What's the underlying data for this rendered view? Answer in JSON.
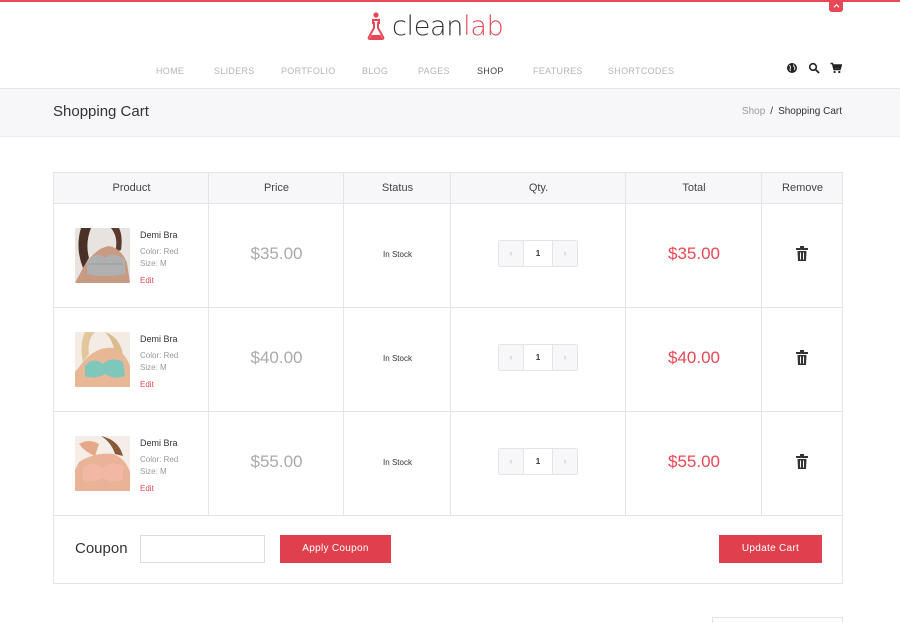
{
  "brand": {
    "name_part1": "clean",
    "name_part2": "lab",
    "accent_color": "#e84855",
    "logo_icon": "flask-person-icon"
  },
  "nav": {
    "items": [
      {
        "label": "HOME",
        "active": false
      },
      {
        "label": "SLIDERS",
        "active": false
      },
      {
        "label": "PORTFOLIO",
        "active": false
      },
      {
        "label": "BLOG",
        "active": false
      },
      {
        "label": "PAGES",
        "active": false
      },
      {
        "label": "SHOP",
        "active": true
      },
      {
        "label": "FEATURES",
        "active": false
      },
      {
        "label": "SHORTCODES",
        "active": false
      }
    ],
    "icons": [
      "globe-icon",
      "search-icon",
      "cart-icon"
    ]
  },
  "page": {
    "title": "Shopping Cart",
    "breadcrumb": {
      "parent": "Shop",
      "separator": "/",
      "current": "Shopping Cart"
    }
  },
  "cart": {
    "columns": [
      "Product",
      "Price",
      "Status",
      "Qty.",
      "Total",
      "Remove"
    ],
    "items": [
      {
        "name": "Demi Bra",
        "color": "Color: Red",
        "size": "Size: M",
        "edit_label": "Edit",
        "price": "$35.00",
        "status": "In Stock",
        "qty": "1",
        "total": "$35.00",
        "product_color": "#b0b0b0"
      },
      {
        "name": "Demi Bra",
        "color": "Color: Red",
        "size": "Size: M",
        "edit_label": "Edit",
        "price": "$40.00",
        "status": "In Stock",
        "qty": "1",
        "total": "$40.00",
        "product_color": "#7fc6bb"
      },
      {
        "name": "Demi Bra",
        "color": "Color: Red",
        "size": "Size: M",
        "edit_label": "Edit",
        "price": "$55.00",
        "status": "In Stock",
        "qty": "1",
        "total": "$55.00",
        "product_color": "#f2b8a4"
      }
    ],
    "qty_dec_symbol": "‹",
    "qty_inc_symbol": "›",
    "coupon_label": "Coupon",
    "coupon_value": "",
    "apply_label": "Apply Coupon",
    "update_label": "Update Cart"
  }
}
